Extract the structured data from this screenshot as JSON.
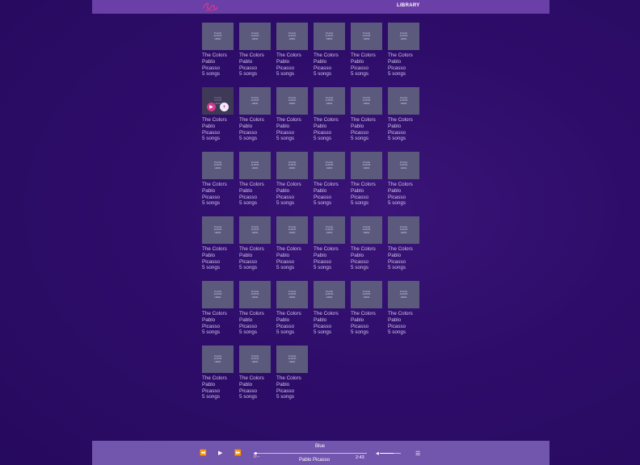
{
  "header": {
    "logo_color": "#d43a8c",
    "nav_label": "LIBRARY"
  },
  "library": {
    "cover_placeholder": "PLACE ALBUM HERE",
    "album_title": "The Colors",
    "artist_line1": "Pablo",
    "artist_line2": "Picasso",
    "song_count": "5 songs",
    "album_count": 33,
    "hovered_index": 6
  },
  "player": {
    "track_title": "Blue",
    "track_artist": "Pablo Picasso",
    "elapsed": "0:--",
    "duration": "2:43",
    "progress": 0.02,
    "volume": 0.65,
    "controls": [
      "previous-icon",
      "play-icon",
      "next-icon",
      "volume-icon",
      "queue-icon"
    ]
  }
}
